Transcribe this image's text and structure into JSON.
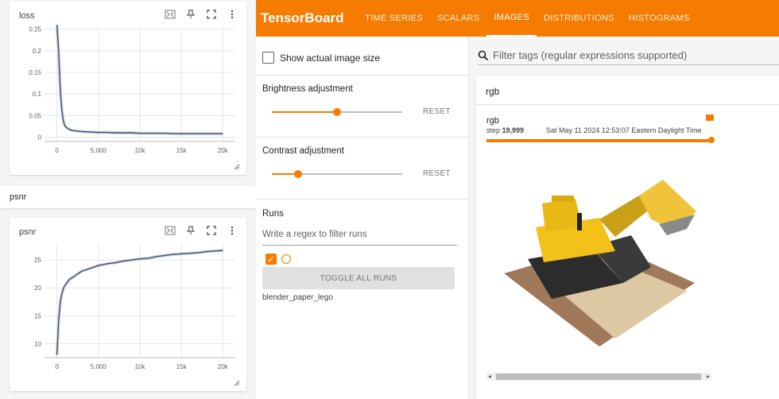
{
  "app": {
    "brand": "TensorBoard"
  },
  "tabs": [
    {
      "label": "TIME SERIES"
    },
    {
      "label": "SCALARS"
    },
    {
      "label": "IMAGES"
    },
    {
      "label": "DISTRIBUTIONS"
    },
    {
      "label": "HISTOGRAMS"
    }
  ],
  "active_tab": "IMAGES",
  "colors": {
    "accent": "#f57c00",
    "line": "#425066",
    "line_raw": "#b4c3dc"
  },
  "loss_card": {
    "title": "loss"
  },
  "psnr_section": {
    "label": "psnr"
  },
  "psnr_card": {
    "title": "psnr"
  },
  "icons": [
    "fit-domain-icon",
    "pin-icon",
    "fullscreen-icon",
    "more-vert-icon",
    "resize-icon",
    "search-icon",
    "expand-icon"
  ],
  "chart_data": [
    {
      "type": "line",
      "title": "loss",
      "xlim": [
        -1500,
        21500
      ],
      "ylim": [
        -0.01,
        0.255
      ],
      "xticks": [
        0,
        5000,
        10000,
        15000,
        20000
      ],
      "xtick_labels": [
        "0",
        "5,000",
        "10k",
        "15k",
        "20k"
      ],
      "yticks": [
        0,
        0.05,
        0.1,
        0.15,
        0.2,
        0.25
      ],
      "ytick_labels": [
        "0",
        "0.05",
        "0.1",
        "0.15",
        "0.2",
        "0.25"
      ],
      "grid": true,
      "series": [
        {
          "x": [
            0,
            200,
            400,
            600,
            800,
            1000,
            1300,
            1600,
            2000,
            2500,
            3000,
            4000,
            5000,
            6000,
            7000,
            8000,
            9000,
            10000,
            11000,
            12000,
            13000,
            14000,
            15000,
            16000,
            17000,
            18000,
            19000,
            20000
          ],
          "y": [
            0.26,
            0.2,
            0.11,
            0.06,
            0.035,
            0.025,
            0.02,
            0.017,
            0.015,
            0.014,
            0.013,
            0.012,
            0.011,
            0.011,
            0.01,
            0.01,
            0.01,
            0.009,
            0.009,
            0.009,
            0.009,
            0.008,
            0.008,
            0.008,
            0.008,
            0.008,
            0.008,
            0.008
          ]
        }
      ]
    },
    {
      "type": "line",
      "title": "psnr",
      "xlim": [
        -1500,
        21500
      ],
      "ylim": [
        7.5,
        28
      ],
      "xticks": [
        0,
        5000,
        10000,
        15000,
        20000
      ],
      "xtick_labels": [
        "0",
        "5,000",
        "10k",
        "15k",
        "20k"
      ],
      "yticks": [
        10,
        15,
        20,
        25
      ],
      "ytick_labels": [
        "10",
        "15",
        "20",
        "25"
      ],
      "grid": true,
      "series": [
        {
          "x": [
            0,
            200,
            400,
            600,
            800,
            1000,
            1500,
            2000,
            2500,
            3000,
            4000,
            5000,
            6000,
            7000,
            8000,
            9000,
            10000,
            11000,
            12000,
            13000,
            14000,
            15000,
            16000,
            17000,
            18000,
            19000,
            20000
          ],
          "y": [
            8,
            14,
            17.5,
            19,
            20,
            20.5,
            21.5,
            22,
            22.5,
            23,
            23.5,
            24,
            24.3,
            24.5,
            24.8,
            25,
            25.2,
            25.3,
            25.6,
            25.8,
            26,
            26.1,
            26.2,
            26.3,
            26.5,
            26.6,
            26.7
          ]
        }
      ]
    }
  ],
  "settings": {
    "show_actual_label": "Show actual image size",
    "brightness_label": "Brightness adjustment",
    "brightness_value": 0.5,
    "contrast_label": "Contrast adjustment",
    "contrast_value": 0.2,
    "reset_label": "RESET"
  },
  "runs": {
    "title": "Runs",
    "filter_placeholder": "Write a regex to filter runs",
    "run_dot": ".",
    "toggle_label": "TOGGLE ALL RUNS",
    "run_name": "blender_paper_lego"
  },
  "images": {
    "search_placeholder": "Filter tags (regular expressions supported)",
    "tag": "rgb",
    "image_title": "rgb",
    "step_prefix": "step",
    "step_value": "19,999",
    "timestamp": "Sat May 11 2024 12:53:07 Eastern Daylight Time"
  }
}
